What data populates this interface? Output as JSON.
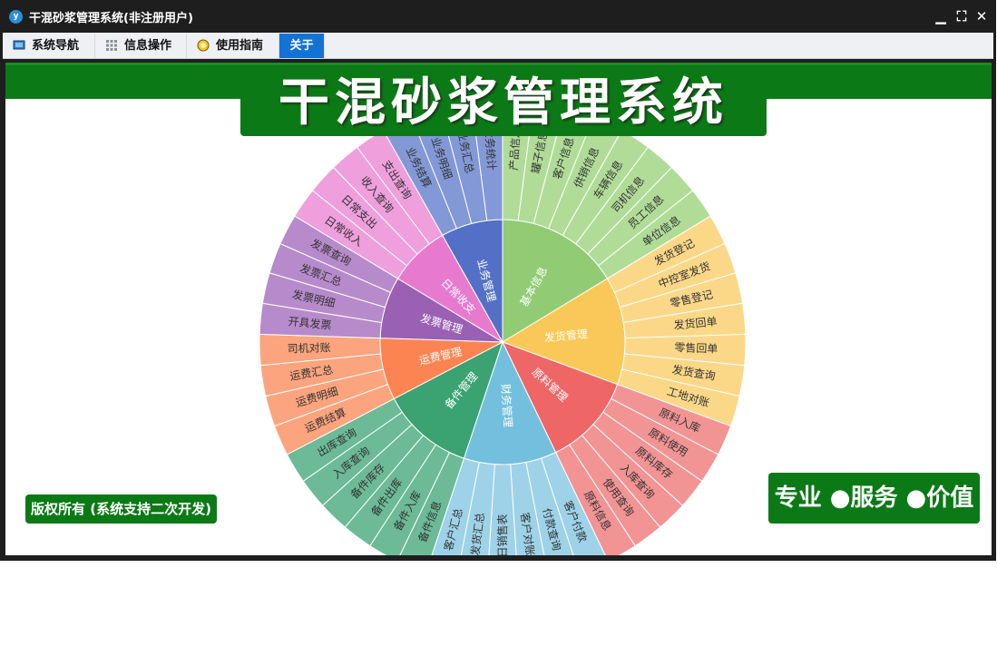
{
  "window": {
    "title": "干混砂浆管理系统(非注册用户)",
    "logo_text": "y",
    "controls": {
      "minimize": "▁",
      "restore": "⛶",
      "close": "✕"
    }
  },
  "tabs": [
    {
      "label": "系统导航",
      "icon": "monitor-icon"
    },
    {
      "label": "信息操作",
      "icon": "grid-icon"
    },
    {
      "label": "使用指南",
      "icon": "bulb-icon"
    },
    {
      "label": "关于",
      "active": true
    }
  ],
  "main_title": "干混砂浆管理系统",
  "copyright": "版权所有 (系统支持二次开发)",
  "slogan": "专业 ●服务 ●价值",
  "sunburst": {
    "categories": [
      {
        "name": "基本信息",
        "color": "#91cc75",
        "light": "#b0dc98",
        "items": [
          "产品信息",
          "罐子信息",
          "客户信息",
          "供销信息",
          "车辆信息",
          "司机信息",
          "员工信息",
          "单位信息"
        ]
      },
      {
        "name": "发货管理",
        "color": "#fac858",
        "light": "#fbd888",
        "items": [
          "发货登记",
          "中控室发货",
          "零售登记",
          "发货回单",
          "零售回单",
          "发货查询",
          "工地对账"
        ]
      },
      {
        "name": "原料管理",
        "color": "#ee6666",
        "light": "#f29494",
        "items": [
          "原料入库",
          "原料使用",
          "原料库存",
          "入库查询",
          "使用查询",
          "原料信息"
        ]
      },
      {
        "name": "财务管理",
        "color": "#73c0de",
        "light": "#9ed2e8",
        "items": [
          "客户付款",
          "付款查询",
          "客户对账",
          "日销售表",
          "发货汇总",
          "客户汇总"
        ]
      },
      {
        "name": "备件管理",
        "color": "#3ba272",
        "light": "#6cba96",
        "items": [
          "备件信息",
          "备件入库",
          "备件出库",
          "备件库存",
          "入库查询",
          "出库查询"
        ]
      },
      {
        "name": "运费管理",
        "color": "#fc8452",
        "light": "#fca47e",
        "items": [
          "运费结算",
          "运费明细",
          "运费汇总",
          "司机对账"
        ]
      },
      {
        "name": "发票管理",
        "color": "#9a60b4",
        "light": "#b78bcb",
        "items": [
          "开具发票",
          "发票明细",
          "发票汇总",
          "发票查询"
        ]
      },
      {
        "name": "日常收支",
        "color": "#e77acf",
        "light": "#ee9fdc",
        "items": [
          "日常收入",
          "日常支出",
          "收入查询",
          "支出查询"
        ]
      },
      {
        "name": "业务管理",
        "color": "#5470c6",
        "light": "#8398d6",
        "items": [
          "业务结算",
          "业务明细",
          "业务汇总",
          "业务统计"
        ]
      }
    ]
  }
}
